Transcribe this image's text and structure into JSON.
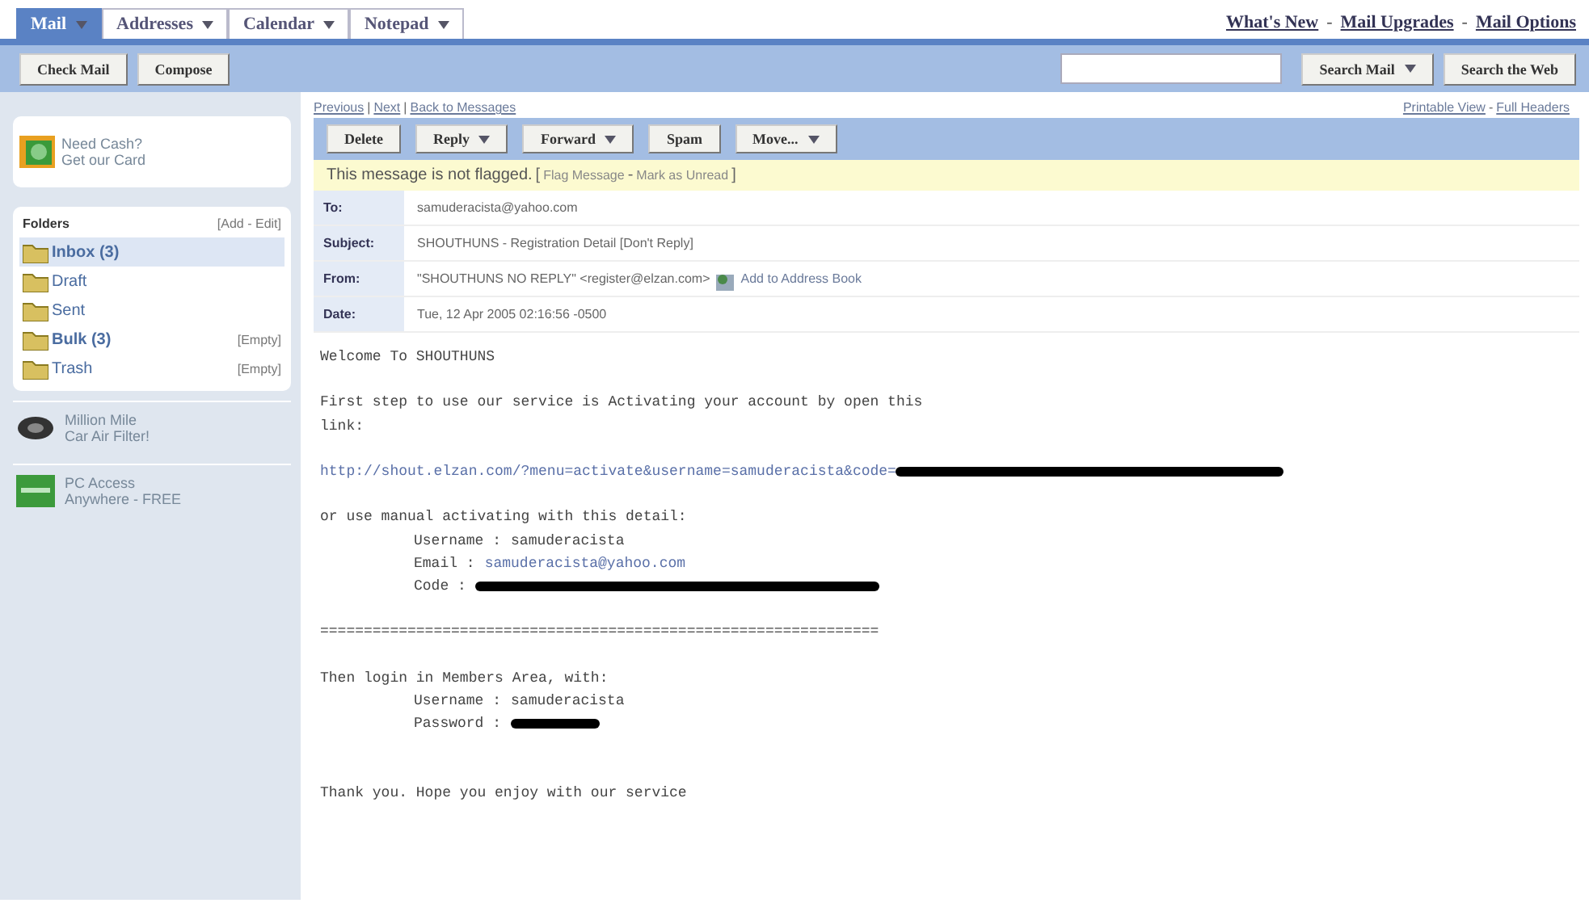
{
  "tabs": [
    {
      "label": "Mail",
      "selected": true
    },
    {
      "label": "Addresses",
      "selected": false
    },
    {
      "label": "Calendar",
      "selected": false
    },
    {
      "label": "Notepad",
      "selected": false
    }
  ],
  "top_links": [
    {
      "kind": "link",
      "text": "What's New"
    },
    {
      "kind": "sep",
      "text": "-"
    },
    {
      "kind": "link",
      "text": "Mail Upgrades"
    },
    {
      "kind": "sep",
      "text": "-"
    },
    {
      "kind": "link",
      "text": "Mail Options"
    }
  ],
  "toolbar": {
    "buttons": [
      "Check Mail",
      "Compose"
    ],
    "search_buttons": [
      {
        "label": "Search Mail",
        "dropdown": true
      },
      {
        "label": "Search the Web",
        "dropdown": false
      }
    ]
  },
  "sidebar": {
    "promo": [
      "Need Cash?",
      "Get our Card"
    ],
    "folders_title": "Folders",
    "folders_action": "[Add - Edit]",
    "folders": [
      {
        "label": "Inbox (3)",
        "bold": true,
        "selected": true
      },
      {
        "label": "Draft",
        "bold": false,
        "selected": false
      },
      {
        "label": "Sent",
        "bold": false,
        "selected": false
      },
      {
        "label": "Bulk (3)",
        "bold": true,
        "selected": false,
        "action": "[Empty]"
      },
      {
        "label": "Trash",
        "bold": false,
        "selected": false,
        "action": "[Empty]"
      }
    ],
    "ads": [
      {
        "kind": "filter",
        "lines": [
          "Million Mile",
          "Car Air Filter!"
        ]
      },
      {
        "kind": "access",
        "lines": [
          "PC Access",
          "Anywhere - FREE"
        ]
      }
    ]
  },
  "message": {
    "nav": [
      {
        "kind": "link",
        "text": "Previous"
      },
      {
        "kind": "sep",
        "text": "|"
      },
      {
        "kind": "link",
        "text": "Next"
      },
      {
        "kind": "sep",
        "text": "|"
      },
      {
        "kind": "link",
        "text": "Back to Messages"
      }
    ],
    "view_links": [
      {
        "kind": "link",
        "text": "Printable View"
      },
      {
        "kind": "sep",
        "text": "-"
      },
      {
        "kind": "link",
        "text": "Full Headers"
      }
    ],
    "actions": [
      {
        "label": "Delete",
        "dropdown": false
      },
      {
        "label": "Reply",
        "dropdown": true
      },
      {
        "label": "Forward",
        "dropdown": true
      },
      {
        "label": "Spam",
        "dropdown": false
      },
      {
        "label": "Move...",
        "dropdown": true
      }
    ],
    "flag_status": "This message is not flagged.",
    "flag_links": [
      {
        "kind": "sep",
        "text": "["
      },
      {
        "kind": "link",
        "text": "Flag Message"
      },
      {
        "kind": "sep",
        "text": "-"
      },
      {
        "kind": "link",
        "text": "Mark as Unread"
      },
      {
        "kind": "sep",
        "text": "]"
      }
    ],
    "headers": [
      {
        "label": "To:",
        "value": "samuderacista@yahoo.com"
      },
      {
        "label": "Subject:",
        "value": "SHOUTHUNS - Registration Detail [Don't Reply]"
      },
      {
        "label": "From:",
        "value": "\"SHOUTHUNS NO REPLY\" <register@elzan.com>",
        "add_link": "Add to Address Book"
      },
      {
        "label": "Date:",
        "value": "Tue, 12 Apr 2005 02:16:56 -0500"
      }
    ],
    "body": [
      {
        "kind": "text",
        "text": "Welcome To SHOUTHUNS"
      },
      {
        "kind": "blank"
      },
      {
        "kind": "text",
        "text": "First step to use our service is Activating your account by open this"
      },
      {
        "kind": "text",
        "text": "link:"
      },
      {
        "kind": "blank"
      },
      {
        "kind": "link",
        "text": "http://shout.elzan.com/?menu=activate&username=samuderacista&code=",
        "redacted": true
      },
      {
        "kind": "blank"
      },
      {
        "kind": "text",
        "text": "or use manual activating with this detail:"
      },
      {
        "kind": "field",
        "label": "Username :",
        "value": "samuderacista"
      },
      {
        "kind": "field",
        "label": "Email :",
        "link": "samuderacista@yahoo.com"
      },
      {
        "kind": "field",
        "label": "Code :",
        "redacted": true
      },
      {
        "kind": "blank"
      },
      {
        "kind": "text",
        "text": "================================================================"
      },
      {
        "kind": "blank"
      },
      {
        "kind": "text",
        "text": "Then login in Members Area, with:"
      },
      {
        "kind": "field",
        "label": "Username :",
        "value": "samuderacista"
      },
      {
        "kind": "field",
        "label": "Password :",
        "redacted": true,
        "short": true
      },
      {
        "kind": "blank"
      },
      {
        "kind": "blank"
      },
      {
        "kind": "text",
        "text": "Thank you. Hope you enjoy with our service"
      }
    ]
  }
}
